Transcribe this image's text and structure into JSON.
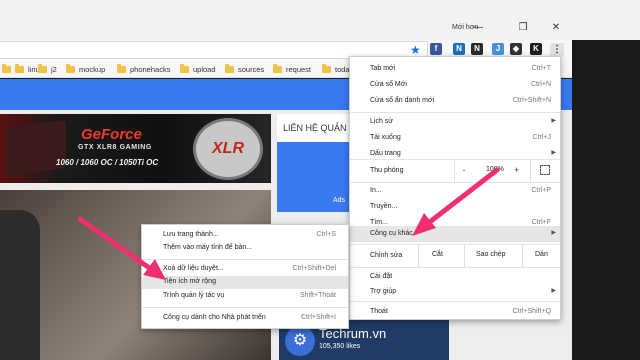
{
  "window": {
    "profile_name": "Mới hơn",
    "minimize": "—",
    "maximize": "❐",
    "close": "✕"
  },
  "toolbar": {
    "star_icon": "star-icon",
    "menu_glyph": "⋮",
    "extensions": [
      {
        "name": "ext-f-icon",
        "glyph": "f",
        "color": "#3b5998"
      },
      {
        "name": "ext-news-icon",
        "glyph": "N",
        "color": "#1d6ebf"
      },
      {
        "name": "ext-n-icon",
        "glyph": "N",
        "color": "#2a2a2a"
      },
      {
        "name": "ext-puzzle-icon",
        "glyph": "J",
        "color": "#4a90d9"
      },
      {
        "name": "ext-shield-icon",
        "glyph": "◆",
        "color": "#333333"
      },
      {
        "name": "ext-k-icon",
        "glyph": "K",
        "color": "#1c1c1c"
      }
    ]
  },
  "bookmarks": [
    {
      "label": "linux"
    },
    {
      "label": "j2"
    },
    {
      "label": "mockup"
    },
    {
      "label": "phonehacks"
    },
    {
      "label": "upload"
    },
    {
      "label": "sources"
    },
    {
      "label": "request"
    },
    {
      "label": "toda"
    }
  ],
  "page": {
    "banner_brand": "GeForce",
    "banner_sub": "GTX XLR8 GAMING",
    "banner_models": "1060 / 1060 OC / 1050Ti OC",
    "banner_badge": "XLR",
    "sidebar_title": "LIÊN HỆ QUẢN",
    "ads_text": "Ads",
    "fb_name": "Techrum.vn",
    "fb_likes": "105,350 likes"
  },
  "menu": {
    "new_tab": {
      "label": "Tab mới",
      "shortcut": "Ctrl+T"
    },
    "new_window": {
      "label": "Cửa sổ Mới",
      "shortcut": "Ctrl+N"
    },
    "incognito": {
      "label": "Cửa sổ ẩn danh mới",
      "shortcut": "Ctrl+Shift+N"
    },
    "history": {
      "label": "Lịch sử"
    },
    "downloads": {
      "label": "Tải xuống",
      "shortcut": "Ctrl+J"
    },
    "bookmarks": {
      "label": "Dấu trang"
    },
    "zoom": {
      "label": "Thu phóng",
      "minus": "-",
      "value": "100%",
      "plus": "+"
    },
    "print": {
      "label": "In...",
      "shortcut": "Ctrl+P"
    },
    "cast": {
      "label": "Truyền..."
    },
    "find": {
      "label": "Tìm...",
      "shortcut": "Ctrl+F"
    },
    "more_tools": {
      "label": "Công cụ khác"
    },
    "edit": {
      "label": "Chỉnh sửa",
      "cut": "Cắt",
      "copy": "Sao chép",
      "paste": "Dán"
    },
    "settings": {
      "label": "Cài đặt"
    },
    "help": {
      "label": "Trợ giúp"
    },
    "exit": {
      "label": "Thoát",
      "shortcut": "Ctrl+Shift+Q"
    }
  },
  "submenu": {
    "save_page": {
      "label": "Lưu trang thành...",
      "shortcut": "Ctrl+S"
    },
    "add_to_desktop": {
      "label": "Thêm vào máy tính để bàn..."
    },
    "clear_data": {
      "label": "Xoá dữ liệu duyệt...",
      "shortcut": "Ctrl+Shift+Del"
    },
    "extensions": {
      "label": "Tiện ích mở rộng"
    },
    "task_manager": {
      "label": "Trình quản lý tác vụ",
      "shortcut": "Shift+Thoát"
    },
    "dev_tools": {
      "label": "Công cụ dành cho Nhà phát triển",
      "shortcut": "Ctrl+Shift+I"
    }
  },
  "colors": {
    "accent_blue": "#3878f0",
    "annotation_pink": "#f0306e"
  }
}
